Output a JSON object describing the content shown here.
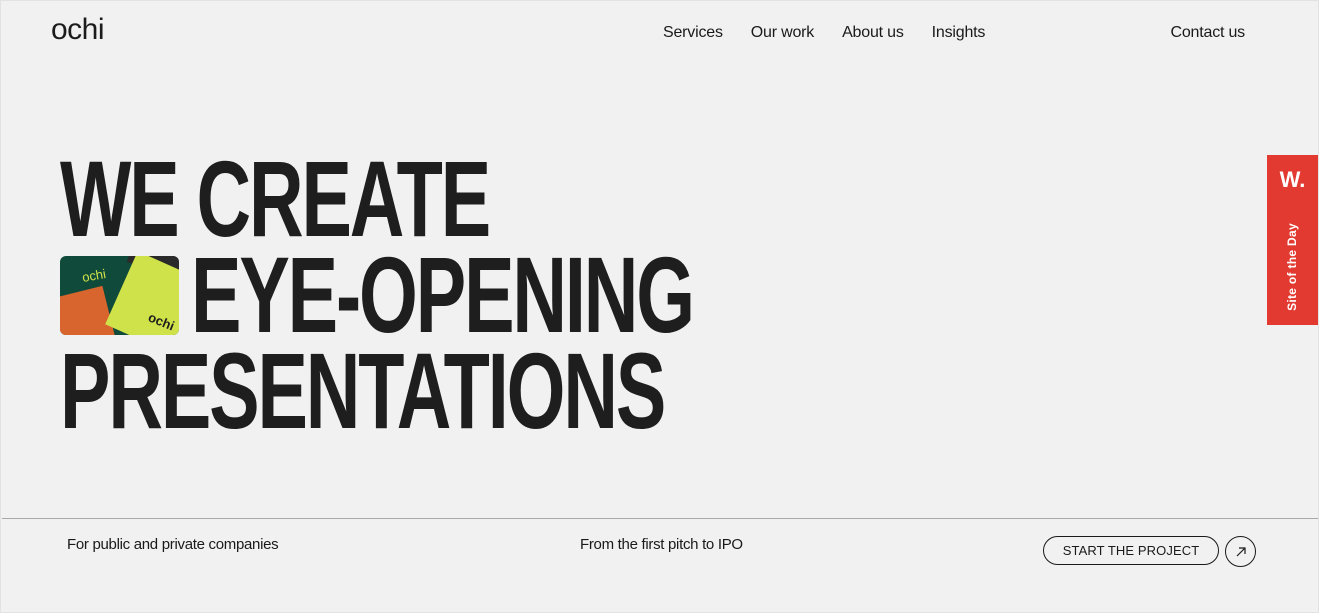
{
  "header": {
    "logo": "ochi",
    "nav": [
      "Services",
      "Our work",
      "About us",
      "Insights"
    ],
    "contact": "Contact us"
  },
  "hero": {
    "line1": "WE CREATE",
    "line2": "EYE-OPENING",
    "line3": "PRESENTATIONS",
    "image_labels": [
      "ochi",
      "ochi"
    ]
  },
  "badge": {
    "mark": "W.",
    "text": "Site of the Day",
    "color": "#e23a31"
  },
  "footer_strip": {
    "left": "For public and private companies",
    "middle": "From the first pitch to IPO",
    "cta_label": "START THE PROJECT",
    "cta_icon": "arrow-up-right-icon"
  }
}
